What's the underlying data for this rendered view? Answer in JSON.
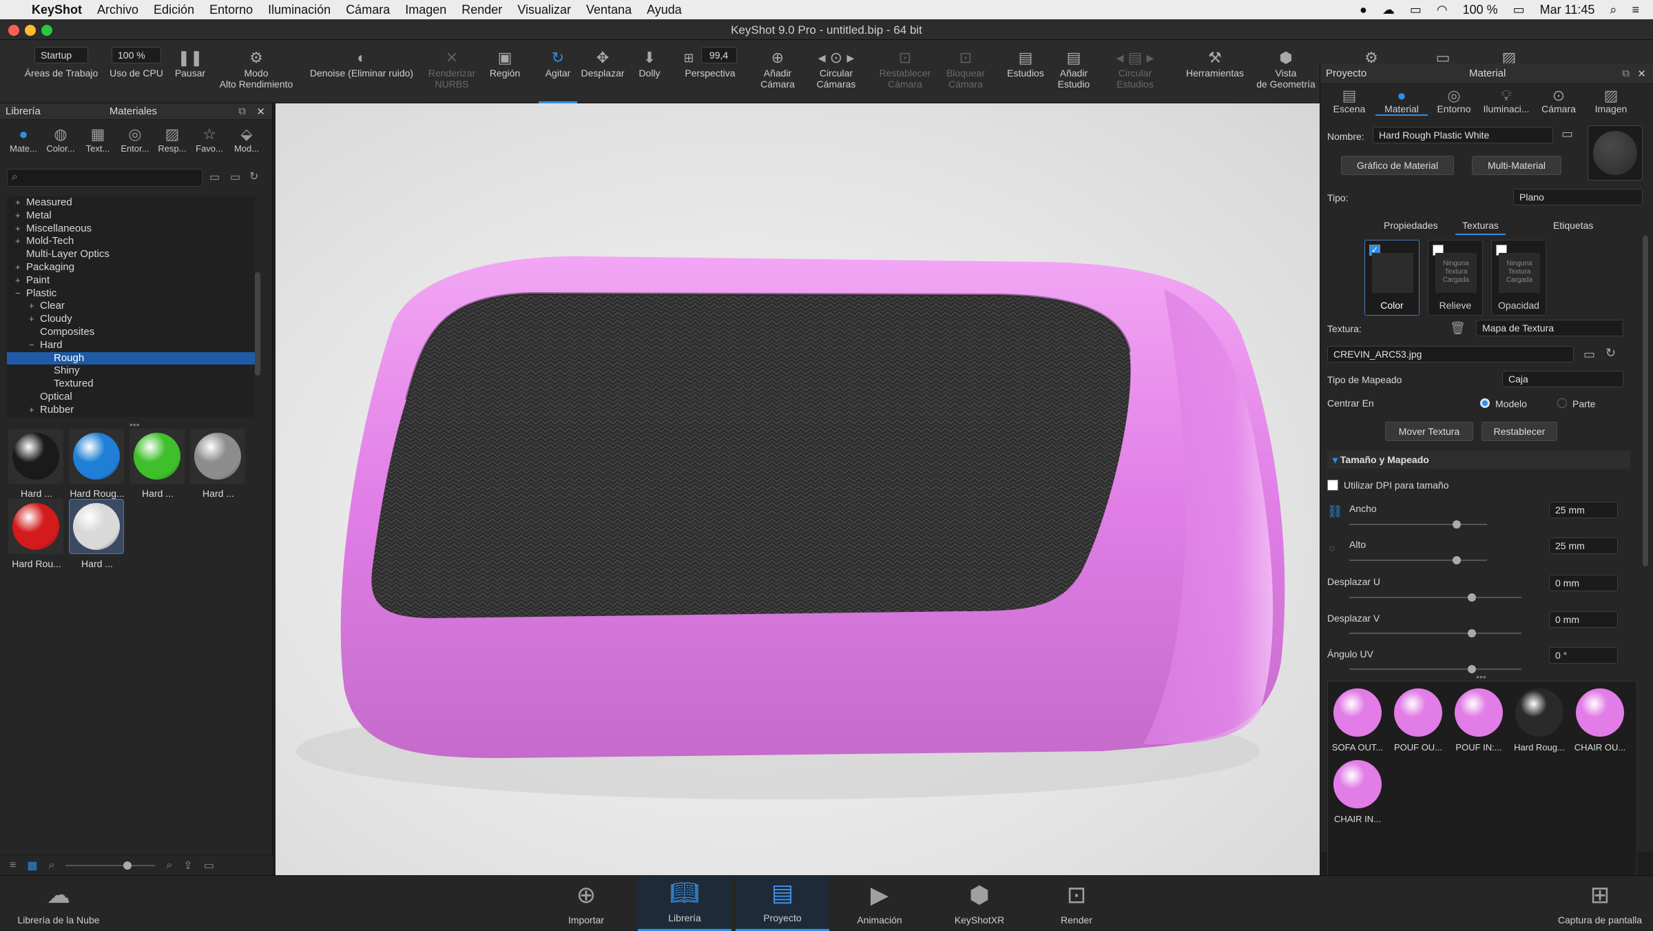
{
  "menubar": {
    "apple_icon": "apple-logo",
    "items": [
      "KeyShot",
      "Archivo",
      "Edición",
      "Entorno",
      "Iluminación",
      "Cámara",
      "Imagen",
      "Render",
      "Visualizar",
      "Ventana",
      "Ayuda"
    ],
    "battery": "100 %",
    "clock": "Mar 11:45"
  },
  "window": {
    "title": "KeyShot 9.0 Pro  - untitled.bip  - 64 bit"
  },
  "toolbar": {
    "workspace_value": "Startup",
    "workspace_label": "Áreas de Trabajo",
    "cpu_value": "100 %",
    "cpu_label": "Uso de CPU",
    "pause_label": "Pausar",
    "perf_label": "Modo\nAlto Rendimiento",
    "denoise_label": "Denoise (Eliminar ruido)",
    "nurbs_label": "Renderizar\nNURBS",
    "region_label": "Región",
    "tumble_label": "Agitar",
    "pan_label": "Desplazar",
    "dolly_label": "Dolly",
    "fov_value": "99,4",
    "perspective_label": "Perspectiva",
    "add_camera_label": "Añadir\nCámara",
    "cycle_cameras_label": "Circular\nCámaras",
    "reset_camera_label": "Restablecer\nCámara",
    "lock_camera_label": "Bloquear\nCámara",
    "studios_label": "Estudios",
    "add_studio_label": "Añadir\nEstudio",
    "cycle_studios_label": "Circular\nEstudios",
    "tools_label": "Herramientas",
    "geometry_view_label": "Vista\nde Geometría"
  },
  "left_panel": {
    "title_library": "Librería",
    "title_materials": "Materiales",
    "tabs": [
      "Mate...",
      "Color...",
      "Text...",
      "Entor...",
      "Resp...",
      "Favo...",
      "Mod..."
    ],
    "tree": [
      {
        "label": "Measured",
        "indent": 0,
        "pm": "+"
      },
      {
        "label": "Metal",
        "indent": 0,
        "pm": "+"
      },
      {
        "label": "Miscellaneous",
        "indent": 0,
        "pm": "+"
      },
      {
        "label": "Mold-Tech",
        "indent": 0,
        "pm": "+"
      },
      {
        "label": "Multi-Layer Optics",
        "indent": 0,
        "pm": ""
      },
      {
        "label": "Packaging",
        "indent": 0,
        "pm": "+"
      },
      {
        "label": "Paint",
        "indent": 0,
        "pm": "+"
      },
      {
        "label": "Plastic",
        "indent": 0,
        "pm": "−"
      },
      {
        "label": "Clear",
        "indent": 1,
        "pm": "+"
      },
      {
        "label": "Cloudy",
        "indent": 1,
        "pm": "+"
      },
      {
        "label": "Composites",
        "indent": 1,
        "pm": ""
      },
      {
        "label": "Hard",
        "indent": 1,
        "pm": "−"
      },
      {
        "label": "Rough",
        "indent": 2,
        "pm": "",
        "selected": true
      },
      {
        "label": "Shiny",
        "indent": 2,
        "pm": ""
      },
      {
        "label": "Textured",
        "indent": 2,
        "pm": ""
      },
      {
        "label": "Optical",
        "indent": 1,
        "pm": ""
      },
      {
        "label": "Rubber",
        "indent": 1,
        "pm": "+"
      }
    ],
    "thumbnails": [
      {
        "label": "Hard ...",
        "color": "#1a1a1a"
      },
      {
        "label": "Hard Roug...",
        "color": "#1f7fd6"
      },
      {
        "label": "Hard ...",
        "color": "#3fbf2a"
      },
      {
        "label": "Hard ...",
        "color": "#8d8d8d"
      },
      {
        "label": "Hard Rou...",
        "color": "#d41a1a"
      },
      {
        "label": "Hard ...",
        "color": "#d9d9d9",
        "selected": true
      }
    ]
  },
  "right_panel": {
    "title_project": "Proyecto",
    "title_material": "Material",
    "tabs": [
      "Escena",
      "Material",
      "Entorno",
      "Iluminaci...",
      "Cámara",
      "Imagen"
    ],
    "name_label": "Nombre:",
    "name_value": "Hard Rough Plastic White",
    "material_graph_button": "Gráfico de Material",
    "multi_material_button": "Multi-Material",
    "type_label": "Tipo:",
    "type_value": "Plano",
    "subtabs": [
      "Propiedades",
      "Texturas",
      "Etiquetas"
    ],
    "texture_slots": [
      {
        "label": "Color",
        "checked": true,
        "placeholder": ""
      },
      {
        "label": "Relieve",
        "checked": false,
        "placeholder": "Ninguna\nTextura\nCargada"
      },
      {
        "label": "Opacidad",
        "checked": false,
        "placeholder": "Ninguna\nTextura\nCargada"
      }
    ],
    "texture_label": "Textura:",
    "texture_value": "Mapa de Textura",
    "texture_file": "CREVIN_ARC53.jpg",
    "mapping_label": "Tipo de Mapeado",
    "mapping_value": "Caja",
    "center_label": "Centrar En",
    "center_model": "Modelo",
    "center_part": "Parte",
    "move_texture_button": "Mover Textura",
    "reset_button": "Restablecer",
    "size_section": "Tamaño y Mapeado",
    "dpi_label": "Utilizar DPI para tamaño",
    "width_label": "Ancho",
    "width_value": "25 mm",
    "height_label": "Alto",
    "height_value": "25 mm",
    "shift_u_label": "Desplazar U",
    "shift_u_value": "0 mm",
    "shift_v_label": "Desplazar V",
    "shift_v_value": "0 mm",
    "angle_label": "Ángulo UV",
    "angle_value": "0 °",
    "scene_materials": [
      {
        "label": "SOFA OUT...",
        "color": "#e27ce6"
      },
      {
        "label": "POUF OU...",
        "color": "#e27ce6"
      },
      {
        "label": "POUF IN:...",
        "color": "#e27ce6"
      },
      {
        "label": "Hard Roug...",
        "color": "#2a2a2a"
      },
      {
        "label": "CHAIR OU...",
        "color": "#e27ce6"
      },
      {
        "label": "CHAIR IN...",
        "color": "#e27ce6"
      }
    ]
  },
  "dock": {
    "cloud_library": "Librería de la Nube",
    "import": "Importar",
    "library": "Librería",
    "project": "Proyecto",
    "animation": "Animación",
    "keyshotxr": "KeyShotXR",
    "render": "Render",
    "screenshot": "Captura de pantalla"
  },
  "colors": {
    "accent": "#2f8fe8",
    "object_pink": "#e07ee6",
    "object_cushion": "#3a3a3a"
  }
}
